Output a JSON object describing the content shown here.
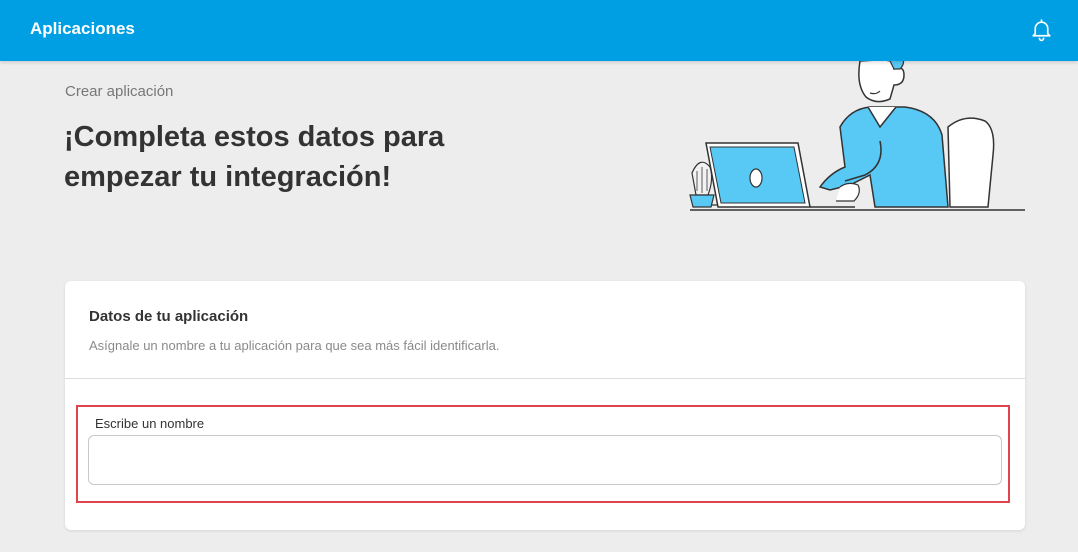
{
  "header": {
    "title": "Aplicaciones",
    "notification_icon": "bell-icon",
    "background_color": "#009ee3"
  },
  "breadcrumb": "Crear aplicación",
  "headline": "¡Completa estos datos para empezar tu integración!",
  "illustration": {
    "description_icon": "person-with-laptop-illustration",
    "accent_color": "#58c8f5"
  },
  "card": {
    "title": "Datos de tu aplicación",
    "description": "Asígnale un nombre a tu aplicación para que sea más fácil identificarla.",
    "name_field": {
      "label": "Escribe un nombre",
      "value": "",
      "placeholder": ""
    },
    "highlight_color": "#e0444c"
  }
}
